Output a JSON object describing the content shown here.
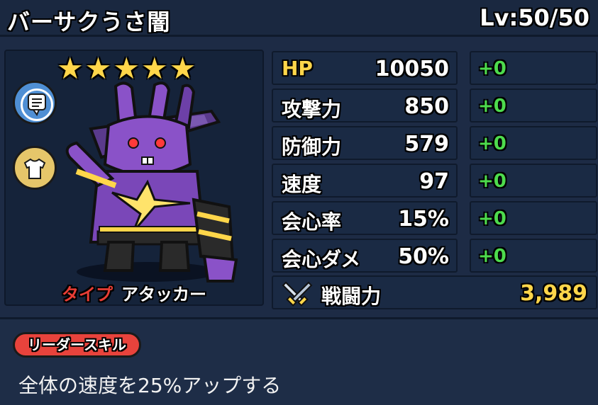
{
  "header": {
    "name": "バーサクうさ闇",
    "level": "Lv:50/50"
  },
  "character": {
    "stars": 5,
    "type_label": "タイプ",
    "type_value": "アタッカー",
    "buttons": [
      "profile-icon",
      "outfit-icon"
    ]
  },
  "stats": [
    {
      "label": "HP",
      "value": "10050",
      "bonus": "+0"
    },
    {
      "label": "攻撃力",
      "value": "850",
      "bonus": "+0"
    },
    {
      "label": "防御力",
      "value": "579",
      "bonus": "+0"
    },
    {
      "label": "速度",
      "value": "97",
      "bonus": "+0"
    },
    {
      "label": "会心率",
      "value": "15%",
      "bonus": "+0"
    },
    {
      "label": "会心ダメ",
      "value": "50%",
      "bonus": "+0"
    }
  ],
  "power": {
    "label": "戦闘力",
    "value": "3,989",
    "icon": "crossed-swords-icon"
  },
  "skill": {
    "badge": "リーダースキル",
    "description": "全体の速度を25%アップする"
  },
  "colors": {
    "background": "#1d2b45",
    "star": "#ffd64a",
    "bonus": "#4ddb4d",
    "type": "#e83d35",
    "badge": "#e8433c"
  }
}
